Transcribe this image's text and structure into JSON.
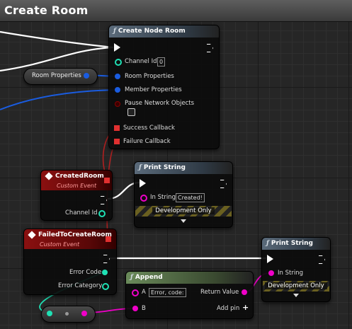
{
  "window": {
    "title": "Create Room"
  },
  "colors": {
    "exec": "#ffffff",
    "int": "#1fe0b4",
    "struct": "#1a5ce0",
    "string": "#f000c8",
    "bool": "#8a0000",
    "delegate": "#e03030",
    "event_header": "#8a1010",
    "function_header": "#4d5a66"
  },
  "nodes": {
    "create_node_room": {
      "title": "Create Node Room",
      "pins": {
        "channel_id": "Channel Id",
        "channel_id_value": "0",
        "room_properties": "Room Properties",
        "member_properties": "Member Properties",
        "pause_network_objects": "Pause Network Objects",
        "success_callback": "Success Callback",
        "failure_callback": "Failure Callback"
      }
    },
    "room_properties_var": {
      "label": "Room Properties"
    },
    "created_room": {
      "title": "CreatedRoom",
      "subtitle": "Custom Event",
      "pins": {
        "channel_id": "Channel Id"
      }
    },
    "print_string_1": {
      "title": "Print String",
      "pins": {
        "in_string": "In String",
        "in_string_value": "Created!"
      },
      "dev_label": "Development Only"
    },
    "failed_to_create_room": {
      "title": "FailedToCreateRoom",
      "subtitle": "Custom Event",
      "pins": {
        "error_code": "Error Code",
        "error_category": "Error Category"
      }
    },
    "print_string_2": {
      "title": "Print String",
      "pins": {
        "in_string": "In String"
      },
      "dev_label": "Development Only"
    },
    "append": {
      "title": "Append",
      "pins": {
        "a": "A",
        "a_value": "Error, code:",
        "b": "B",
        "return_value": "Return Value",
        "add_pin": "Add pin"
      }
    }
  },
  "icons": {
    "function": "function-icon",
    "event": "event-diamond-icon",
    "add": "plus-icon"
  }
}
